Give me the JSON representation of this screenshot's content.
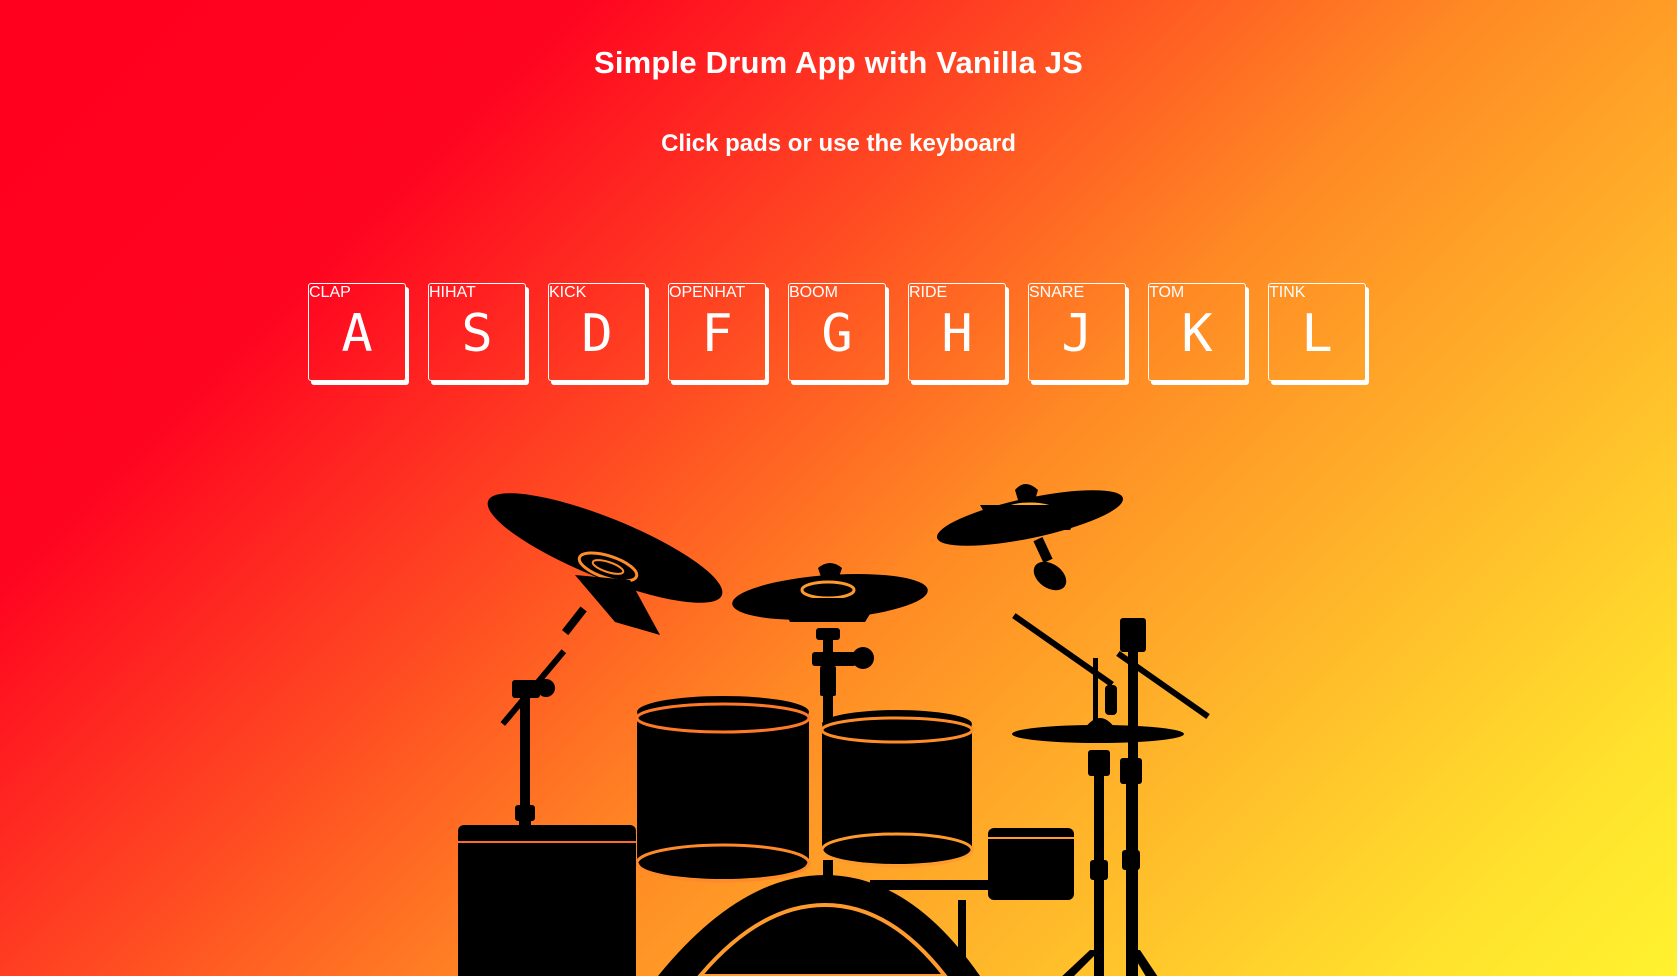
{
  "header": {
    "title": "Simple Drum App with Vanilla JS",
    "subtitle": "Click pads or use the keyboard"
  },
  "pads": [
    {
      "sound": "CLAP",
      "key": "A"
    },
    {
      "sound": "HIHAT",
      "key": "S"
    },
    {
      "sound": "KICK",
      "key": "D"
    },
    {
      "sound": "OPENHAT",
      "key": "F"
    },
    {
      "sound": "BOOM",
      "key": "G"
    },
    {
      "sound": "RIDE",
      "key": "H"
    },
    {
      "sound": "SNARE",
      "key": "J"
    },
    {
      "sound": "TOM",
      "key": "K"
    },
    {
      "sound": "TINK",
      "key": "L"
    }
  ],
  "illustration": {
    "icon": "drum-kit-silhouette-icon"
  },
  "colors": {
    "gradient_start": "#ff001e",
    "gradient_end": "#fff22f",
    "pad_border": "#ffffff",
    "text": "#ffffff",
    "silhouette": "#000000"
  }
}
